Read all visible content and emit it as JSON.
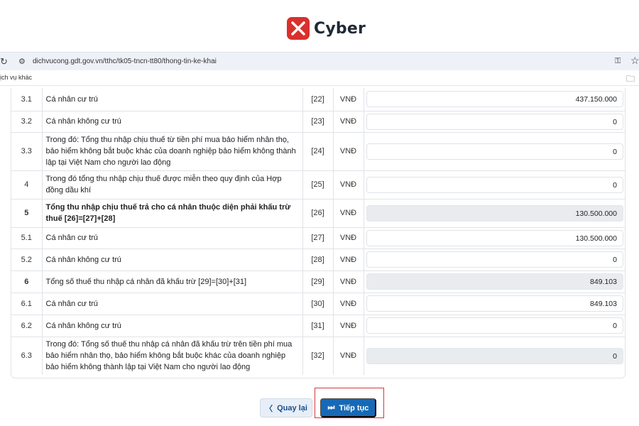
{
  "brand": {
    "name": "Cyber"
  },
  "browser": {
    "url": "dichvucong.gdt.gov.vn/tthc/tk05-tncn-tt80/thong-tin-ke-khai",
    "bookmark": "ịch vụ khác"
  },
  "rows": [
    {
      "no": "3.1",
      "desc": "Cá nhân cư trú",
      "code": "[22]",
      "unit": "VNĐ",
      "value": "437.150.000",
      "readonly": false,
      "bold": false
    },
    {
      "no": "3.2",
      "desc": "Cá nhân không cư trú",
      "code": "[23]",
      "unit": "VNĐ",
      "value": "0",
      "readonly": false,
      "bold": false
    },
    {
      "no": "3.3",
      "desc": "Trong đó: Tổng thu nhập chịu thuế từ tiền phí mua bảo hiểm nhân thọ, bảo hiểm không bắt buộc khác của doanh nghiệp bảo hiểm không thành lập tại Việt Nam cho người lao động",
      "code": "[24]",
      "unit": "VNĐ",
      "value": "0",
      "readonly": false,
      "bold": false
    },
    {
      "no": "4",
      "desc": "Trong đó tổng thu nhập chịu thuế được miễn theo quy định của Hợp đồng dầu khí",
      "code": "[25]",
      "unit": "VNĐ",
      "value": "0",
      "readonly": false,
      "bold": false
    },
    {
      "no": "5",
      "desc": "Tổng thu nhập chịu thuế trả cho cá nhân thuộc diện phải khấu trừ thuế [26]=[27]+[28]",
      "code": "[26]",
      "unit": "VNĐ",
      "value": "130.500.000",
      "readonly": true,
      "bold": true
    },
    {
      "no": "5.1",
      "desc": "Cá nhân cư trú",
      "code": "[27]",
      "unit": "VNĐ",
      "value": "130.500.000",
      "readonly": false,
      "bold": false
    },
    {
      "no": "5.2",
      "desc": "Cá nhân không cư trú",
      "code": "[28]",
      "unit": "VNĐ",
      "value": "0",
      "readonly": false,
      "bold": false
    },
    {
      "no": "6",
      "desc": "Tổng số thuế thu nhập cá nhân đã khấu trừ [29]=[30]+[31]",
      "code": "[29]",
      "unit": "VNĐ",
      "value": "849.103",
      "readonly": true,
      "bold": false,
      "bold_no": true
    },
    {
      "no": "6.1",
      "desc": "Cá nhân cư trú",
      "code": "[30]",
      "unit": "VNĐ",
      "value": "849.103",
      "readonly": false,
      "bold": false
    },
    {
      "no": "6.2",
      "desc": "Cá nhân không cư trú",
      "code": "[31]",
      "unit": "VNĐ",
      "value": "0",
      "readonly": false,
      "bold": false
    },
    {
      "no": "6.3",
      "desc": "Trong đó: Tổng số thuế thu nhập cá nhân đã khấu trừ trên tiền phí mua bảo hiểm nhân thọ, bảo hiểm không bắt buộc khác của doanh nghiệp bảo hiểm không thành lập tại Việt Nam cho người lao động",
      "code": "[32]",
      "unit": "VNĐ",
      "value": "0",
      "readonly": true,
      "bold": false
    }
  ],
  "actions": {
    "back_label": "Quay lại",
    "next_label": "Tiếp tục"
  },
  "colors": {
    "primary": "#1769b6",
    "brand_red": "#d9302c",
    "highlight_outline": "#d6383a"
  }
}
